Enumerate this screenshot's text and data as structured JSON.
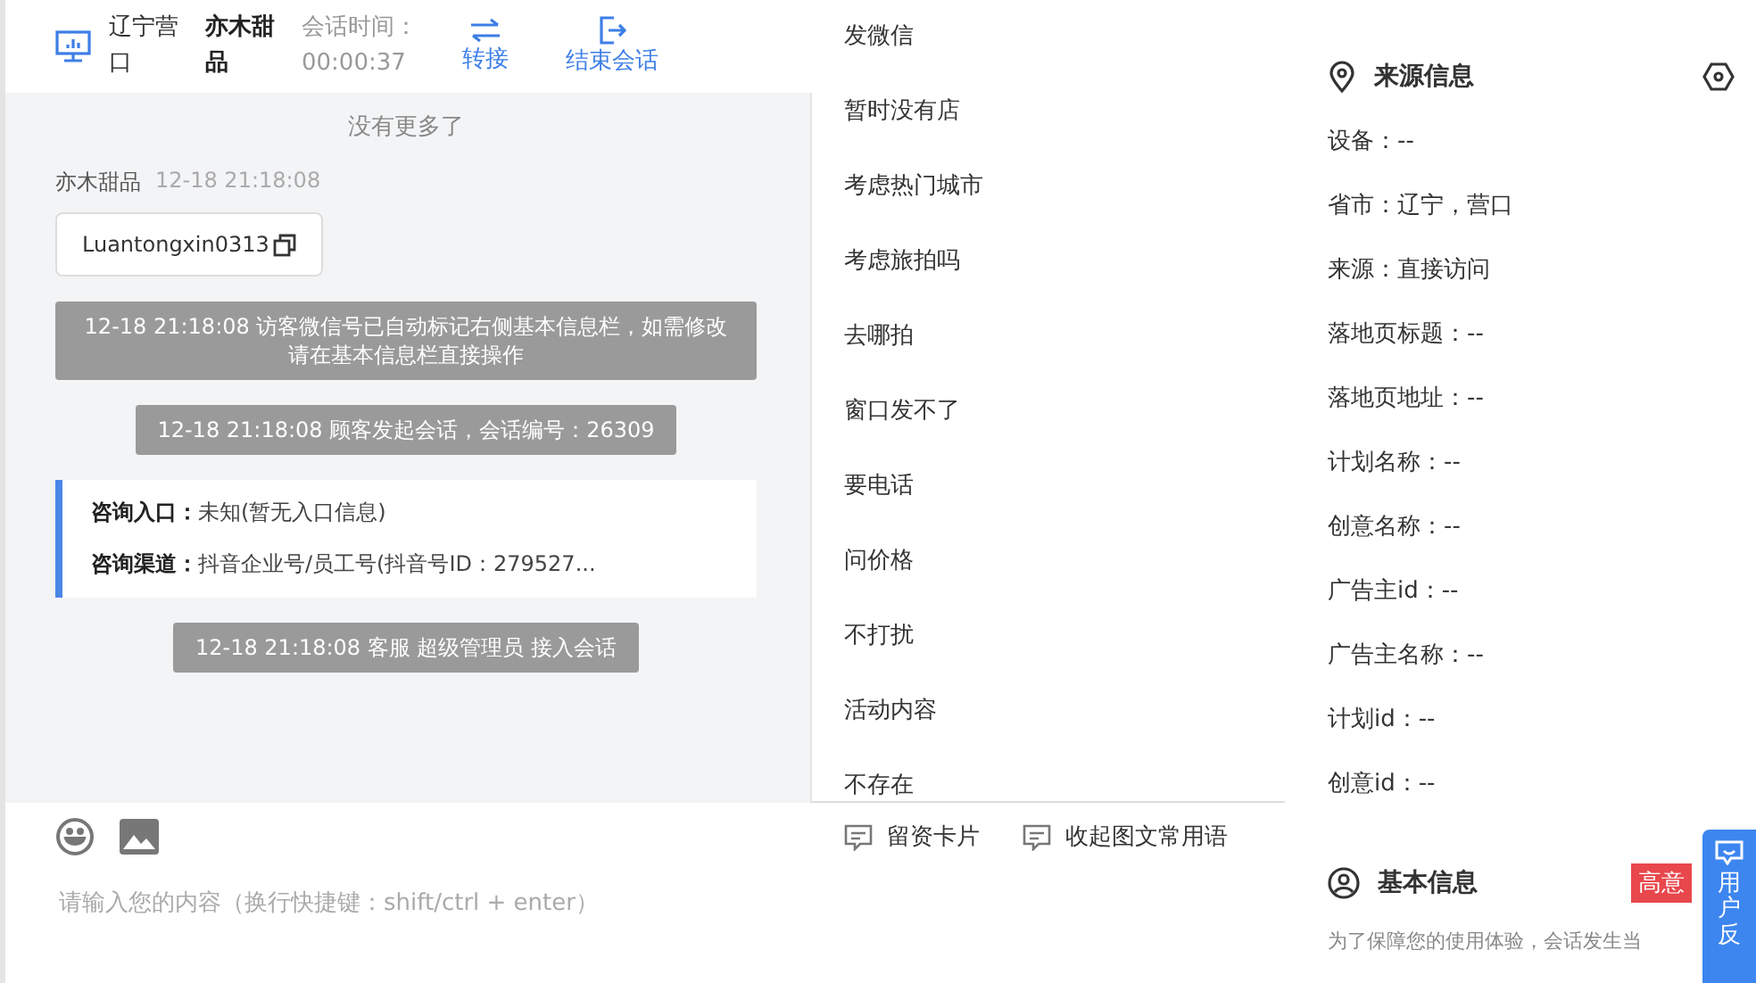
{
  "header": {
    "location": "辽宁营口",
    "visitor": "亦木甜品",
    "timer_label": "会话时间：",
    "timer": "00:00:37",
    "actions": [
      {
        "kind": "transfer",
        "label": "转接"
      },
      {
        "kind": "end",
        "label": "结束会话"
      }
    ]
  },
  "chat": {
    "no_more": "没有更多了",
    "messages": [
      {
        "kind": "visitor",
        "sender": "亦木甜品",
        "time": "12-18 21:18:08",
        "text": "Luantongxin0313"
      },
      {
        "kind": "system",
        "text": "12-18 21:18:08 访客微信号已自动标记右侧基本信息栏，如需修改请在基本信息栏直接操作"
      },
      {
        "kind": "system",
        "text": "12-18 21:18:08 顾客发起会话，会话编号：26309"
      },
      {
        "kind": "info",
        "rows": [
          {
            "label": "咨询入口：",
            "value": "未知(暂无入口信息)"
          },
          {
            "label": "咨询渠道：",
            "value": "抖音企业号/员工号(抖音号ID：279527..."
          }
        ]
      },
      {
        "kind": "system",
        "text": "12-18 21:18:08 客服 超级管理员 接入会话"
      }
    ]
  },
  "quick_phrases": [
    "发微信",
    "暂时没有店",
    "考虑热门城市",
    "考虑旅拍吗",
    "去哪拍",
    "窗口发不了",
    "要电话",
    "问价格",
    "不打扰",
    "活动内容",
    "不存在"
  ],
  "composer": {
    "tools": [
      "留资卡片",
      "收起图文常用语"
    ],
    "placeholder": "请输入您的内容（换行快捷键：shift/ctrl + enter）"
  },
  "source_info": {
    "title": "来源信息",
    "fields": [
      "设备：--",
      "省市：辽宁，营口",
      "来源：直接访问",
      "落地页标题：--",
      "落地页地址：--",
      "计划名称：--",
      "创意名称：--",
      "广告主id：--",
      "广告主名称：--",
      "计划id：--",
      "创意id：--"
    ]
  },
  "basic_info": {
    "title": "基本信息",
    "tag": "高意",
    "note": "为了保障您的使用体验，会话发生当"
  },
  "feedback": "用户反"
}
